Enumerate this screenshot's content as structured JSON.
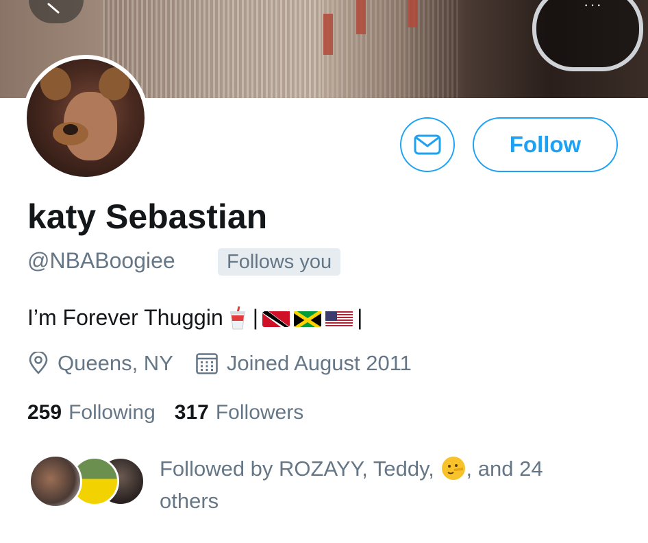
{
  "header": {
    "back_icon": "chevron-left-icon",
    "more_icon": "more-dots-icon",
    "more_text": "···"
  },
  "profile": {
    "name": "katy Sebastian",
    "handle": "@NBABoogiee",
    "follows_you": "Follows you",
    "bio_text": "I’m Forever Thuggin",
    "bio_separator": "|",
    "bio_end": "|",
    "bio_icons": [
      "cup-with-straw-icon",
      "flag-trinidad-tobago-icon",
      "flag-jamaica-icon",
      "flag-united-states-icon"
    ],
    "location": "Queens, NY",
    "joined": "Joined August 2011",
    "following_count": "259",
    "following_label": "Following",
    "followers_count": "317",
    "followers_label": "Followers"
  },
  "actions": {
    "message_icon": "envelope-icon",
    "follow_label": "Follow"
  },
  "followed_by": {
    "prefix": "Followed by ROZAYY, Teddy,",
    "emoji": "lying-face-emoji",
    "suffix": ", and 24 others"
  },
  "colors": {
    "accent": "#1da1f2",
    "text_primary": "#14171a",
    "text_secondary": "#657786",
    "badge_bg": "#e6ecf0"
  }
}
